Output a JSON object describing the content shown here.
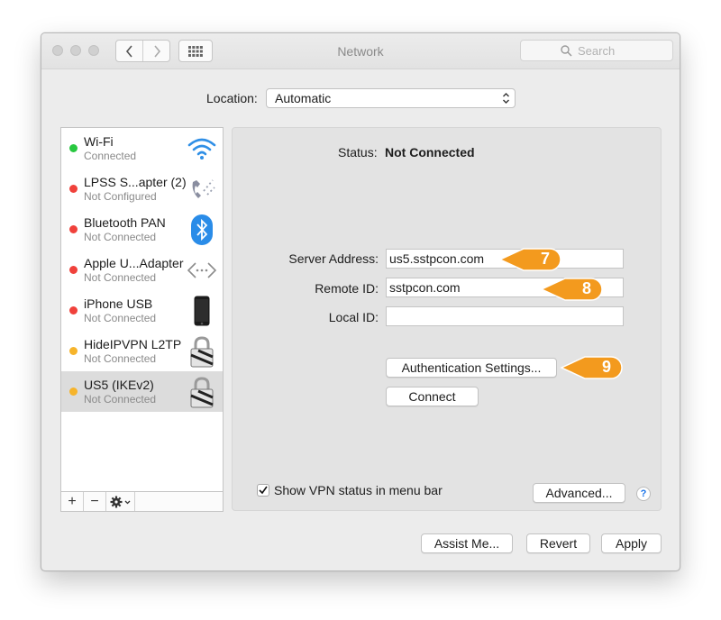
{
  "window": {
    "title": "Network"
  },
  "search": {
    "placeholder": "Search"
  },
  "location": {
    "label": "Location:",
    "value": "Automatic"
  },
  "services": [
    {
      "name": "Wi-Fi",
      "status": "Connected",
      "dot_color": "#28c840",
      "icon": "wifi-icon"
    },
    {
      "name": "LPSS S...apter (2)",
      "status": "Not Configured",
      "dot_color": "#f0413b",
      "icon": "phone-modem-icon"
    },
    {
      "name": "Bluetooth PAN",
      "status": "Not Connected",
      "dot_color": "#f0413b",
      "icon": "bluetooth-icon"
    },
    {
      "name": "Apple U...Adapter",
      "status": "Not Connected",
      "dot_color": "#f0413b",
      "icon": "ethernet-adapter-icon"
    },
    {
      "name": "iPhone USB",
      "status": "Not Connected",
      "dot_color": "#f0413b",
      "icon": "iphone-icon"
    },
    {
      "name": "HideIPVPN L2TP",
      "status": "Not Connected",
      "dot_color": "#f6b42b",
      "icon": "vpn-lock-icon"
    },
    {
      "name": "US5 (IKEv2)",
      "status": "Not Connected",
      "dot_color": "#f6b42b",
      "icon": "vpn-lock-icon",
      "selected": true
    }
  ],
  "sidebar_bar": {
    "add": "+",
    "remove": "−"
  },
  "detail": {
    "status_label": "Status:",
    "status_value": "Not Connected",
    "server_address_label": "Server Address:",
    "server_address_value": "us5.sstpcon.com",
    "remote_id_label": "Remote ID:",
    "remote_id_value": "sstpcon.com",
    "local_id_label": "Local ID:",
    "local_id_value": "",
    "auth_button": "Authentication Settings...",
    "connect_button": "Connect",
    "show_vpn_label": "Show VPN status in menu bar",
    "show_vpn_checked": true,
    "advanced_button": "Advanced...",
    "help": "?"
  },
  "callouts": {
    "server": "7",
    "remote": "8",
    "auth": "9",
    "color": "#f39a1e"
  },
  "footer": {
    "assist": "Assist Me...",
    "revert": "Revert",
    "apply": "Apply"
  }
}
